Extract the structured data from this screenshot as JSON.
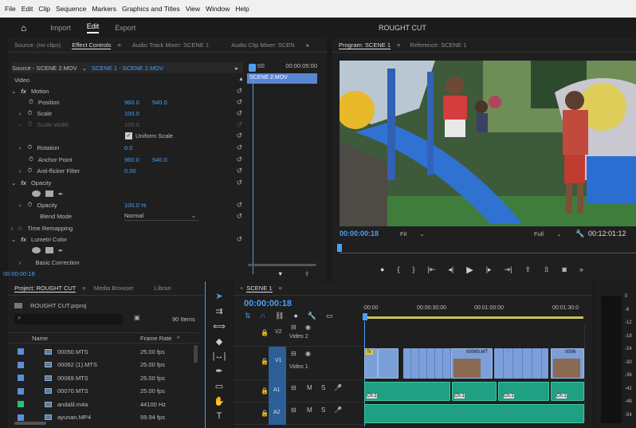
{
  "menu": [
    "File",
    "Edit",
    "Clip",
    "Sequence",
    "Markers",
    "Graphics and Titles",
    "View",
    "Window",
    "Help"
  ],
  "workspace": {
    "tabs": [
      "Import",
      "Edit",
      "Export"
    ],
    "active": "Edit",
    "project_title": "ROUGHT CUT"
  },
  "source_panel": {
    "tabs": [
      "Source: (no clips)",
      "Effect Controls",
      "Audio Track Mixer: SCENE 1",
      "Audio Clip Mixer: SCEN"
    ],
    "active_tab": "Effect Controls",
    "source_label": "Source - SCENE 2.MOV",
    "sequence_label": "SCENE 1 - SCENE 2.MOV",
    "time_start": "00:00",
    "time_end": "00:00:05:00",
    "clip_label": "SCENE 2.MOV",
    "section": "Video",
    "motion": "Motion",
    "position": "Position",
    "pos_x": "960.0",
    "pos_y": "540.0",
    "scale": "Scale",
    "scale_val": "100.0",
    "scale_width": "Scale Width",
    "scale_width_val": "100.0",
    "uniform": "Uniform Scale",
    "rotation": "Rotation",
    "rotation_val": "0.0",
    "anchor": "Anchor Point",
    "anchor_x": "960.0",
    "anchor_y": "540.0",
    "antiflicker": "Anti-flicker Filter",
    "antiflicker_val": "0.00",
    "opacity_fx": "Opacity",
    "opacity": "Opacity",
    "opacity_val": "100.0 %",
    "blend": "Blend Mode",
    "blend_val": "Normal",
    "time_remap": "Time Remapping",
    "lumetri": "Lumetri Color",
    "basic": "Basic Correction",
    "timecode": "00:00:00:18"
  },
  "program": {
    "tabs": [
      "Program: SCENE 1",
      "Reference: SCENE 1"
    ],
    "active_tab": "Program: SCENE 1",
    "timecode": "00:00:00:18",
    "fit": "Fit",
    "full": "Full",
    "duration": "00:12:01:12"
  },
  "project": {
    "tabs": [
      "Project: ROUGHT CUT",
      "Media Browser",
      "Librari"
    ],
    "active_tab": "Project: ROUGHT CUT",
    "file": "ROUGHT CUT.prproj",
    "items_count": "90 Items",
    "col_name": "Name",
    "col_rate": "Frame Rate",
    "rows": [
      {
        "name": "00050.MTS",
        "rate": "25.00 fps",
        "color": "#5b8ed6"
      },
      {
        "name": "00062 (1).MTS",
        "rate": "25.00 fps",
        "color": "#5b8ed6"
      },
      {
        "name": "00069.MTS",
        "rate": "25.00 fps",
        "color": "#5b8ed6"
      },
      {
        "name": "00070.MTS",
        "rate": "25.00 fps",
        "color": "#5b8ed6"
      },
      {
        "name": "andalil.m4a",
        "rate": "44100 Hz",
        "color": "#2fbf72"
      },
      {
        "name": "ayunan.MP4",
        "rate": "59.94 fps",
        "color": "#5b8ed6"
      }
    ]
  },
  "timeline": {
    "tab": "SCENE 1",
    "timecode": "00:00:00:18",
    "ruler": [
      ":00:00",
      "00:00:30:00",
      "00:01:00:00",
      "00:01:30:0"
    ],
    "tracks": [
      {
        "id": "V2",
        "name": "Video 2"
      },
      {
        "id": "V1",
        "name": "Video 1"
      },
      {
        "id": "A1",
        "name": ""
      },
      {
        "id": "A2",
        "name": ""
      }
    ],
    "clip_labels": [
      "fx",
      "00069.MT",
      "fx",
      "0006"
    ],
    "audio_labels": [
      "Ch.1",
      "Ch.1",
      "Ch.1",
      "Ch.1"
    ]
  },
  "meter_labels": [
    "0",
    "-6",
    "-12",
    "-18",
    "-24",
    "-30",
    "-36",
    "-42",
    "-48",
    "-54"
  ],
  "colors": {
    "accent": "#4a9ff5",
    "video_clip": "#7b9fd8",
    "audio_clip": "#1fa083",
    "playhead": "#4a9ff5",
    "fx_badge": "#e0c641"
  }
}
